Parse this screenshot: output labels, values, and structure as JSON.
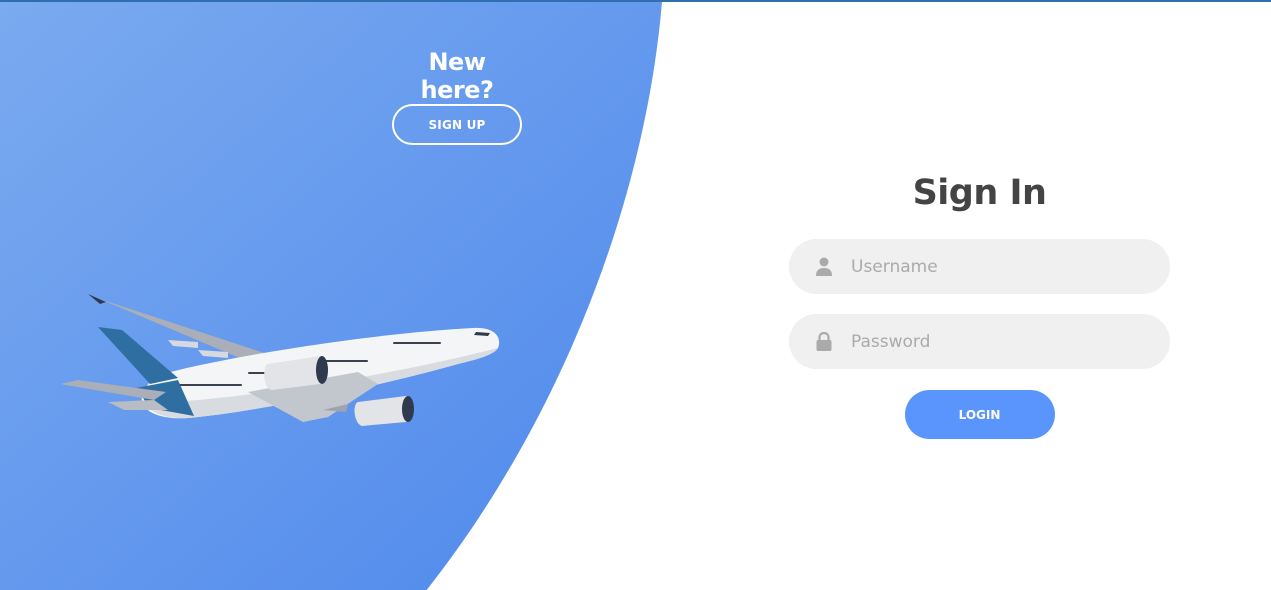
{
  "panel": {
    "title": "New here?",
    "signup_label": "SIGN UP"
  },
  "form": {
    "title": "Sign In",
    "username": {
      "placeholder": "Username",
      "value": ""
    },
    "password": {
      "placeholder": "Password",
      "value": ""
    },
    "login_label": "LOGIN"
  },
  "icons": {
    "username": "user-icon",
    "password": "lock-icon",
    "illustration": "airplane-illustration"
  },
  "colors": {
    "accent": "#5995fd",
    "panel_light": "#7aaaef",
    "panel_dark": "#4e88ec",
    "field_bg": "#f0f0f0",
    "title": "#444444",
    "placeholder": "#aaaaaa"
  }
}
